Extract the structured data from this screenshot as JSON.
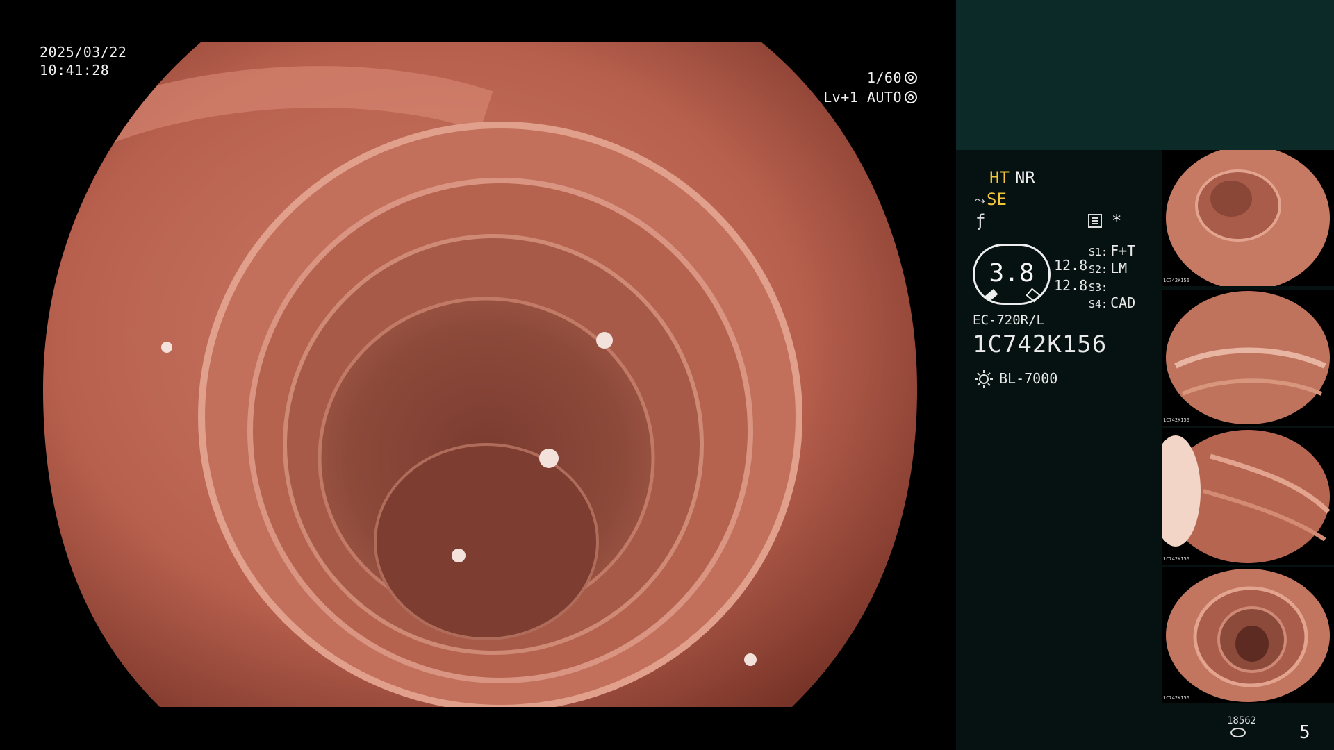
{
  "osd": {
    "date": "2025/03/22",
    "time": "10:41:28",
    "shutter": "1/60",
    "iris": "Lv+1 AUTO"
  },
  "panel": {
    "ht": "HT",
    "nr": "NR",
    "se": "SE",
    "se_icon": "tilde-arrow-icon",
    "freeze_icon": "f-slash-icon",
    "star": "*",
    "zoom": "3.8",
    "focus_1": "12.8",
    "focus_2": "12.8",
    "scenes": [
      {
        "key": "S1:",
        "value": "F+T"
      },
      {
        "key": "S2:",
        "value": "LM"
      },
      {
        "key": "S3:",
        "value": ""
      },
      {
        "key": "S4:",
        "value": "CAD"
      }
    ],
    "scope_model": "EC-720R/L",
    "scope_serial": "1C742K156",
    "light_source": "BL-7000",
    "storage_count": "18562",
    "image_count": "5"
  },
  "thumbnails": [
    {
      "caption": "1C742K156"
    },
    {
      "caption": "1C742K156"
    },
    {
      "caption": "1C742K156"
    },
    {
      "caption": "1C742K156"
    }
  ],
  "colors": {
    "highlight": "#f2c53d",
    "panel_bg": "#061211",
    "panel_header": "#0b2a28",
    "mucosa": "#b8604e"
  }
}
